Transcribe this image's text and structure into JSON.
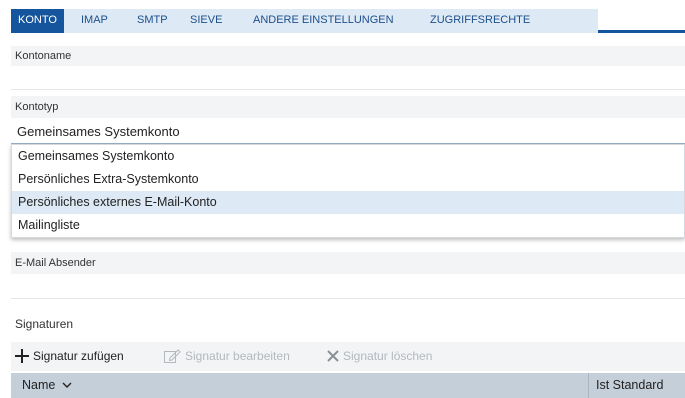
{
  "tabs": [
    {
      "label": "KONTO",
      "active": true
    },
    {
      "label": "IMAP",
      "active": false
    },
    {
      "label": "SMTP",
      "active": false
    },
    {
      "label": "SIEVE",
      "active": false
    },
    {
      "label": "ANDERE EINSTELLUNGEN",
      "active": false
    },
    {
      "label": "ZUGRIFFSRECHTE",
      "active": false
    }
  ],
  "form": {
    "kontoname_label": "Kontoname",
    "kontoname_value": "",
    "kontotyp_label": "Kontotyp",
    "kontotyp_value": "Gemeinsames Systemkonto",
    "kontotyp_options": [
      "Gemeinsames Systemkonto",
      "Persönliches Extra-Systemkonto",
      "Persönliches externes E-Mail-Konto",
      "Mailingliste"
    ],
    "kontotyp_highlighted_option": "Persönliches externes E-Mail-Konto",
    "absender_label": "E-Mail Absender",
    "absender_value": "",
    "signaturen_label": "Signaturen"
  },
  "toolbar": {
    "add_label": "Signatur zufügen",
    "edit_label": "Signatur bearbeiten",
    "delete_label": "Signatur löschen"
  },
  "table": {
    "col_name": "Name",
    "col_default": "Ist Standard"
  },
  "colors": {
    "accent": "#14559d",
    "tab_strip": "#dde9f5",
    "highlight": "#dde9f5",
    "header_bg": "#c4cfda"
  }
}
